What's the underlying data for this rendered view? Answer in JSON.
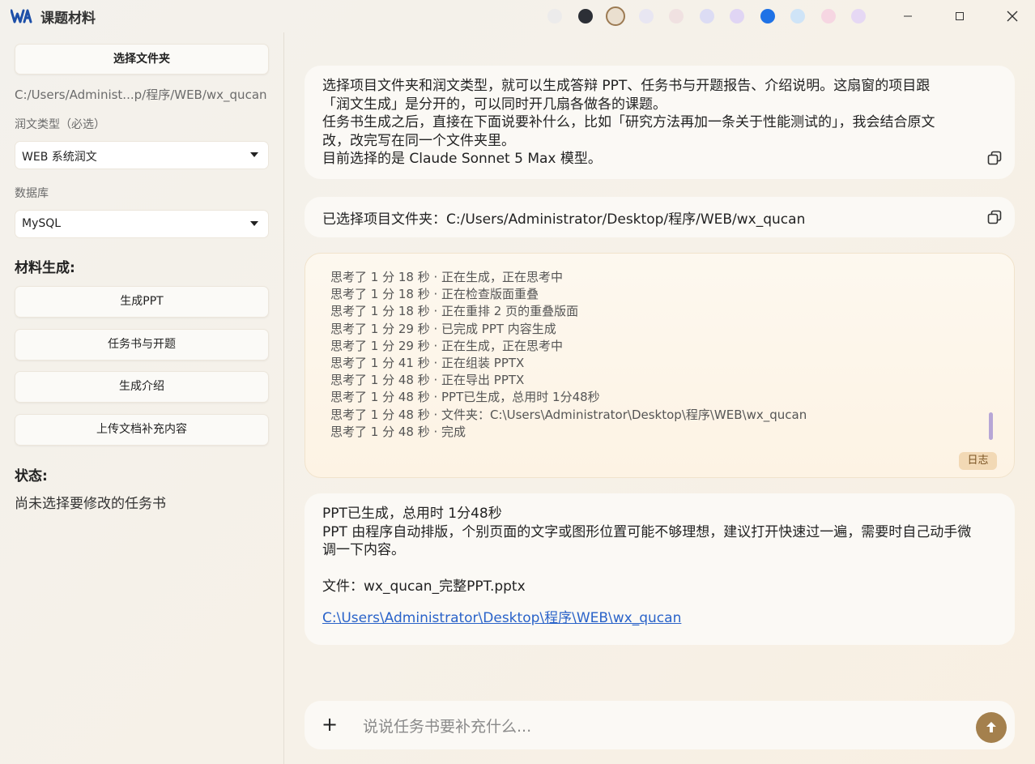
{
  "app": {
    "title": "课题材料"
  },
  "theme_swatches": [
    {
      "name": "ivory",
      "color": "#ecebeb",
      "selected": false
    },
    {
      "name": "dark",
      "color": "#2c2f36",
      "selected": false
    },
    {
      "name": "beige",
      "color": "#eadfcf",
      "selected": true
    },
    {
      "name": "lavender-mist",
      "color": "#e8e6f2",
      "selected": false
    },
    {
      "name": "blush",
      "color": "#f0e1e1",
      "selected": false
    },
    {
      "name": "periwinkle",
      "color": "#dcdcf4",
      "selected": false
    },
    {
      "name": "lilac",
      "color": "#e0d5f4",
      "selected": false
    },
    {
      "name": "blue",
      "color": "#1f72e6",
      "selected": false
    },
    {
      "name": "sky",
      "color": "#cfe4f7",
      "selected": false
    },
    {
      "name": "pink",
      "color": "#f6d6e2",
      "selected": false
    },
    {
      "name": "violet-mist",
      "color": "#e6d8f4",
      "selected": false
    }
  ],
  "sidebar": {
    "select_folder_label": "选择文件夹",
    "folder_path": "C:/Users/Administ...p/程序/WEB/wx_qucan",
    "polish_type_label": "润文类型（必选）",
    "polish_type_value": "WEB 系统润文",
    "database_label": "数据库",
    "database_value": "MySQL",
    "materials_heading": "材料生成:",
    "actions": {
      "ppt": "生成PPT",
      "task_book": "任务书与开题",
      "intro": "生成介绍",
      "upload": "上传文档补充内容"
    },
    "status_heading": "状态:",
    "status_text": "尚未选择要修改的任务书"
  },
  "chat": {
    "intro_lines": [
      "选择项目文件夹和润文类型，就可以生成答辩 PPT、任务书与开题报告、介绍说明。这扇窗的项目跟",
      "「润文生成」是分开的，可以同时开几扇各做各的课题。",
      "任务书生成之后，直接在下面说要补什么，比如「研究方法再加一条关于性能测试的」，我会结合原文",
      "改，改完写在同一个文件夹里。",
      "目前选择的是 Claude Sonnet 5 Max 模型。"
    ],
    "folder_msg": "已选择项目文件夹：C:/Users/Administrator/Desktop/程序/WEB/wx_qucan",
    "log_lines": [
      "思考了 1 分 18 秒 · 正在生成，正在思考中",
      "思考了 1 分 18 秒 · 正在检查版面重叠",
      "思考了 1 分 18 秒 · 正在重排 2 页的重叠版面",
      "思考了 1 分 29 秒 · 已完成 PPT 内容生成",
      "思考了 1 分 29 秒 · 正在生成，正在思考中",
      "思考了 1 分 41 秒 · 正在组装 PPTX",
      "思考了 1 分 48 秒 · 正在导出 PPTX",
      "思考了 1 分 48 秒 · PPT已生成，总用时 1分48秒",
      "思考了 1 分 48 秒 · 文件夹：C:\\Users\\Administrator\\Desktop\\程序\\WEB\\wx_qucan",
      "思考了 1 分 48 秒 · 完成"
    ],
    "log_tag": "日志",
    "result": {
      "line1": "PPT已生成，总用时 1分48秒",
      "line2": "PPT 由程序自动排版，个别页面的文字或图形位置可能不够理想，建议打开快速过一遍，需要时自己动手微",
      "line3": "调一下内容。",
      "file": "文件：wx_qucan_完整PPT.pptx",
      "link": "C:\\Users\\Administrator\\Desktop\\程序\\WEB\\wx_qucan"
    }
  },
  "composer": {
    "placeholder": "说说任务书要补充什么..."
  }
}
